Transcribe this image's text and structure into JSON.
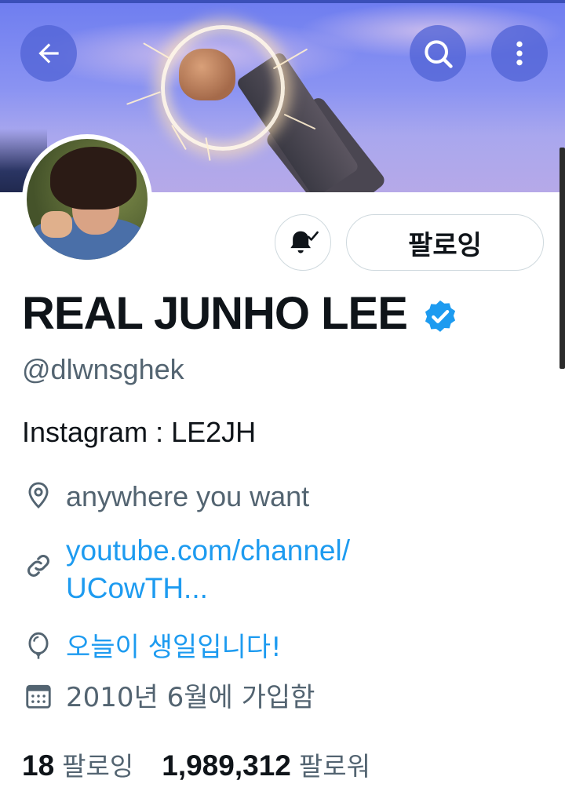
{
  "header": {
    "back_icon": "arrow-left-icon",
    "search_icon": "search-icon",
    "more_icon": "more-vertical-icon"
  },
  "profile": {
    "display_name": "REAL JUNHO LEE",
    "verified": true,
    "handle": "@dlwnsghek",
    "bio": "Instagram : LE2JH",
    "location": "anywhere you want",
    "link_line1": "youtube.com/channel/",
    "link_line2": "UCowTH...",
    "birthday_text": "오늘이 생일입니다!",
    "joined_text": "2010년 6월에 가입함"
  },
  "actions": {
    "notifications_icon": "bell-check-icon",
    "follow_label": "팔로잉"
  },
  "stats": {
    "following_count": "18",
    "following_label": "팔로잉",
    "followers_count": "1,989,312",
    "followers_label": "팔로워"
  },
  "colors": {
    "accent": "#1d9bf0",
    "secondary_text": "#536471",
    "primary_text": "#0f1419",
    "header_button": "#5264d6"
  }
}
